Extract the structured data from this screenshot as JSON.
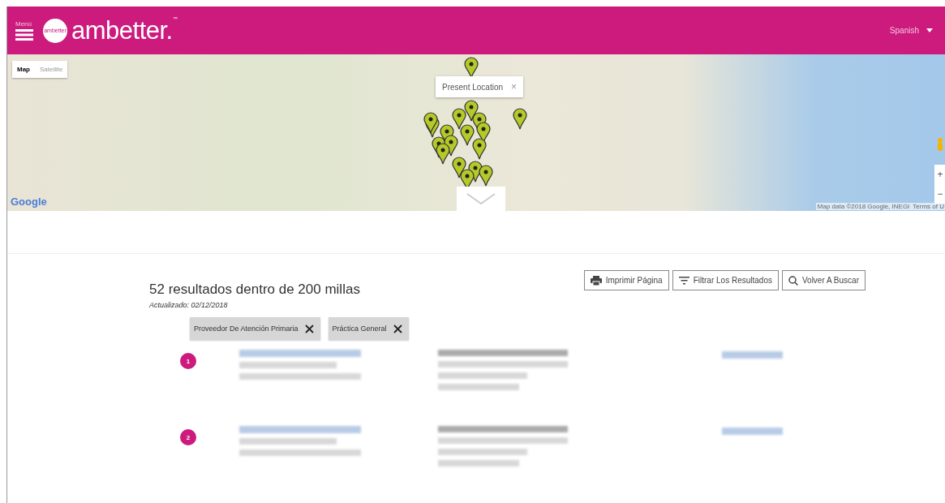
{
  "header": {
    "menu_label": "Menú",
    "logo_badge": "ambetter",
    "logo_text": "ambetter.",
    "logo_mark": "™",
    "language": "Spanish"
  },
  "map": {
    "types": [
      {
        "label": "Map",
        "selected": true
      },
      {
        "label": "Satellite",
        "selected": false
      }
    ],
    "popup": "Present Location",
    "popup_close": "×",
    "zoom_in": "+",
    "zoom_out": "−",
    "attribution": "Map data ©2018 Google, INEGI",
    "terms": "Terms of U",
    "google": "Google"
  },
  "results": {
    "title": "52 resultados dentro de 200 millas",
    "updated": "Actualizado: 02/12/2018",
    "actions": [
      {
        "kind": "print",
        "label": "Imprimir Página"
      },
      {
        "kind": "filter",
        "label": "Filtrar Los Resultados"
      },
      {
        "kind": "search",
        "label": "Volver A Buscar"
      }
    ],
    "filters": [
      {
        "label": "Proveedor De Atención Primaria"
      },
      {
        "label": "Práctica General"
      }
    ],
    "items": [
      {
        "number": "1"
      },
      {
        "number": "2"
      }
    ]
  }
}
